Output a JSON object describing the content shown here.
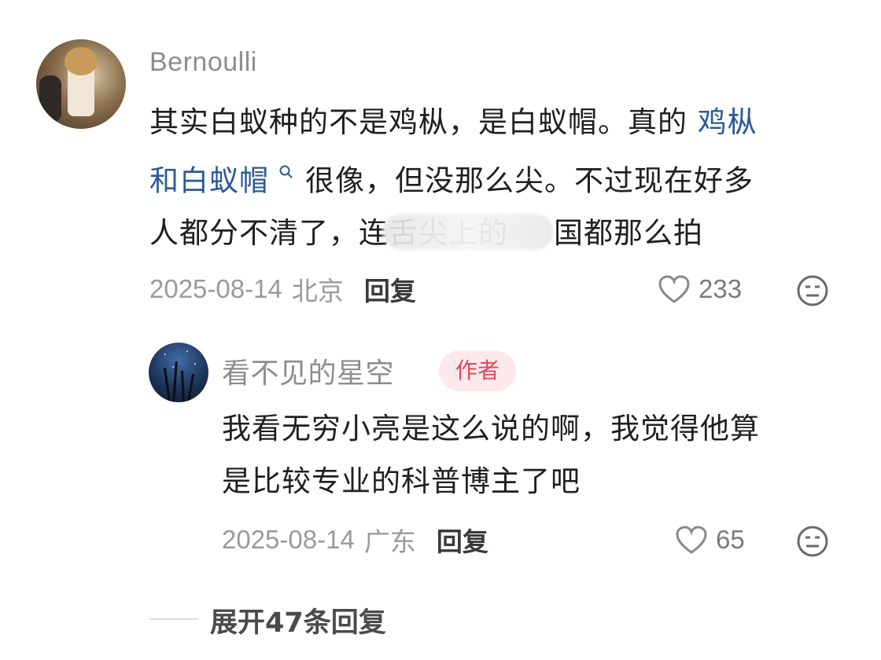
{
  "comment": {
    "username": "Bernoulli",
    "text_line1": "其实白蚁种的不是鸡枞，是白蚁帽。真的 ",
    "link1": "鸡枞",
    "link2": "和白蚁帽",
    "text_line2_rest": "很像，但没那么尖。不过现在好多",
    "text_line3_a": "人都分不清了，连舌尖上的",
    "text_line3_b": "国都那么拍",
    "date": "2025-08-14",
    "location": "北京",
    "reply_label": "回复",
    "likes": "233"
  },
  "reply": {
    "username": "看不见的星空",
    "badge": "作者",
    "text_line1": "我看无穷小亮是这么说的啊，我觉得他算",
    "text_line2": "是比较专业的科普博主了吧",
    "date": "2025-08-14",
    "location": "广东",
    "reply_label": "回复",
    "likes": "65"
  },
  "expand_label": "展开47条回复",
  "colors": {
    "link": "#2c5a96",
    "badge_bg": "#fde9ec",
    "badge_text": "#e2455a"
  },
  "icons": [
    "search-icon",
    "heart-icon",
    "dislike-face-icon"
  ]
}
